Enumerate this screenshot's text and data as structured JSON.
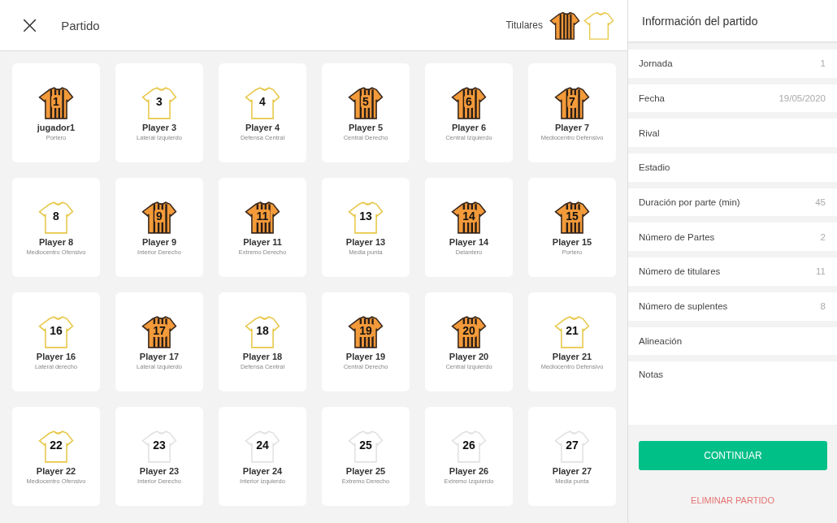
{
  "header": {
    "close": "×",
    "title": "Partido",
    "kits_label": "Titulares",
    "kits": [
      {
        "kind": "striped"
      },
      {
        "kind": "outline"
      }
    ]
  },
  "players": [
    {
      "number": "1",
      "name": "jugador1",
      "position": "Portero",
      "kind": "striped"
    },
    {
      "number": "3",
      "name": "Player 3",
      "position": "Lateral Izquierdo",
      "kind": "outline"
    },
    {
      "number": "4",
      "name": "Player 4",
      "position": "Defensa Central",
      "kind": "outline"
    },
    {
      "number": "5",
      "name": "Player 5",
      "position": "Central Derecho",
      "kind": "striped"
    },
    {
      "number": "6",
      "name": "Player 6",
      "position": "Central Izquierdo",
      "kind": "striped"
    },
    {
      "number": "7",
      "name": "Player 7",
      "position": "Mediocentro Defensivo",
      "kind": "striped"
    },
    {
      "number": "8",
      "name": "Player 8",
      "position": "Mediocentro Ofensivo",
      "kind": "outline"
    },
    {
      "number": "9",
      "name": "Player 9",
      "position": "Interior Derecho",
      "kind": "striped"
    },
    {
      "number": "11",
      "name": "Player 11",
      "position": "Extremo Derecho",
      "kind": "striped"
    },
    {
      "number": "13",
      "name": "Player 13",
      "position": "Media punta",
      "kind": "outline"
    },
    {
      "number": "14",
      "name": "Player 14",
      "position": "Delantero",
      "kind": "striped"
    },
    {
      "number": "15",
      "name": "Player 15",
      "position": "Portero",
      "kind": "striped"
    },
    {
      "number": "16",
      "name": "Player 16",
      "position": "Lateral derecho",
      "kind": "outline"
    },
    {
      "number": "17",
      "name": "Player 17",
      "position": "Lateral Izquierdo",
      "kind": "striped"
    },
    {
      "number": "18",
      "name": "Player 18",
      "position": "Defensa Central",
      "kind": "outline"
    },
    {
      "number": "19",
      "name": "Player 19",
      "position": "Central Derecho",
      "kind": "striped"
    },
    {
      "number": "20",
      "name": "Player 20",
      "position": "Central Izquierdo",
      "kind": "striped"
    },
    {
      "number": "21",
      "name": "Player 21",
      "position": "Mediocentro Defensivo",
      "kind": "outline"
    },
    {
      "number": "22",
      "name": "Player 22",
      "position": "Mediocentro Ofensivo",
      "kind": "outline"
    },
    {
      "number": "23",
      "name": "Player 23",
      "position": "Interior Derecho",
      "kind": "blank"
    },
    {
      "number": "24",
      "name": "Player 24",
      "position": "Interior izquierdo",
      "kind": "blank"
    },
    {
      "number": "25",
      "name": "Player 25",
      "position": "Extremo Derecho",
      "kind": "blank"
    },
    {
      "number": "26",
      "name": "Player 26",
      "position": "Extremo Izquierdo",
      "kind": "blank"
    },
    {
      "number": "27",
      "name": "Player 27",
      "position": "Media punta",
      "kind": "blank"
    }
  ],
  "info_panel": {
    "title": "Información del partido",
    "fields": [
      {
        "label": "Jornada",
        "value": "1"
      },
      {
        "label": "Fecha",
        "value": "19/05/2020"
      },
      {
        "label": "Rival"
      },
      {
        "label": "Estadio"
      },
      {
        "label": "Duración por parte (min)",
        "value": "45"
      },
      {
        "label": "Número de Partes",
        "value": "2"
      },
      {
        "label": "Número de titulares",
        "value": "11"
      },
      {
        "label": "Número de suplentes",
        "value": "8"
      },
      {
        "label": "Alineación"
      }
    ],
    "notes_label": "Notas",
    "continue_button": "CONTINUAR",
    "delete_link": "ELIMINAR PARTIDO"
  }
}
